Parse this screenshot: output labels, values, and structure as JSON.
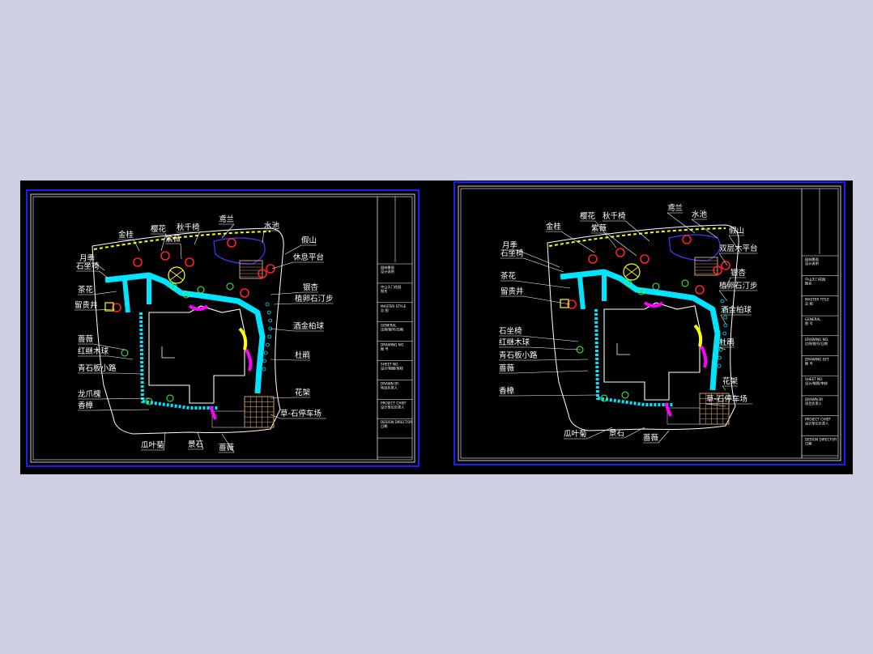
{
  "sheets": [
    {
      "id": "left",
      "labels": [
        "金桂",
        "樱花",
        "秋千椅",
        "鸢兰",
        "水池",
        "紫薇",
        "月季",
        "石坐椅",
        "假山",
        "休息平台",
        "茶花",
        "银杏",
        "留贵井",
        "植卵石汀步",
        "酒金柏球",
        "蔷薇",
        "红继木球",
        "杜鹃",
        "青石板小路",
        "龙爪槐",
        "花架",
        "香樟",
        "草-石停车场",
        "瓜叶菊",
        "景石",
        "蔷薇"
      ],
      "titleblock": [
        "园林景观",
        "设计说明",
        "中山天门花园",
        "图名",
        "MASTER STYLE",
        "总 图",
        "GENERAL",
        "比例/图号/日期",
        "DRAWING NO.",
        "图 号",
        "SHEET NO.",
        "设计/制图/审核",
        "DRAWN BY",
        "项目负责人",
        "PROJECT CHIEF",
        "设计单位负责人",
        "DESIGN DIRECTOR",
        "日期"
      ]
    },
    {
      "id": "right",
      "labels": [
        "金桂",
        "樱花",
        "秋千椅",
        "鸢兰",
        "水池",
        "紫薇",
        "月季",
        "石坐椅",
        "假山",
        "双层木平台",
        "茶花",
        "银杏",
        "留贵井",
        "植卵石汀步",
        "酒金柏球",
        "石坐椅",
        "红继木球",
        "杜鹃",
        "青石板小路",
        "蔷薇",
        "花架",
        "香樟",
        "草-石停车场",
        "瓜叶菊",
        "景石",
        "蔷薇"
      ],
      "titleblock": [
        "园林景观",
        "设计说明",
        "中山天门花园",
        "图名",
        "MASTER TITLE",
        "总 图",
        "GENERAL",
        "图 号",
        "DRAWING NO.",
        "比例/图号/日期",
        "DRAWING SET",
        "图 号",
        "SHEET NO.",
        "设计/制图/审核",
        "DRAWN BY",
        "项目负责人",
        "PROJECT CHIEF",
        "设计单位负责人",
        "DESIGN DIRECTOR",
        "日期"
      ]
    }
  ],
  "colors": {
    "background": "#cfcfe3",
    "canvas": "#000000",
    "frame": "#1c1cff",
    "path": "#00e5ff",
    "lawn": "#ffffff",
    "hedge_magenta": "#ff00ff",
    "hedge_yellow": "#ffff00",
    "tree_red": "#ff2020",
    "parking": "#c8a060",
    "deck": "#c8a078",
    "water": "#3b3bff"
  }
}
